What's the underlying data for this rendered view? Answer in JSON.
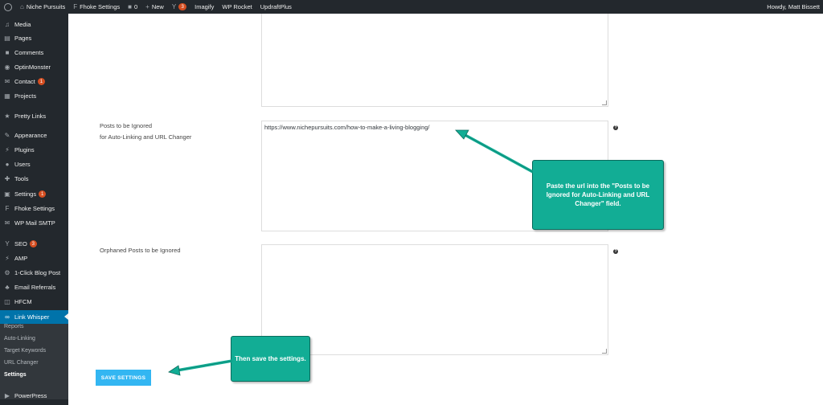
{
  "admin_bar": {
    "site_name": "Niche Pursuits",
    "fhoke": "Fhoke Settings",
    "comments_count": "0",
    "new_label": "New",
    "yoast_badge": "3",
    "imagify": "Imagify",
    "wp_rocket": "WP Rocket",
    "updraft": "UpdraftPlus",
    "howdy": "Howdy, Matt Bissett"
  },
  "sidebar": {
    "items": [
      {
        "label": "Media",
        "icon": "media-icon",
        "glyph": "♫"
      },
      {
        "label": "Pages",
        "icon": "pages-icon",
        "glyph": "▤"
      },
      {
        "label": "Comments",
        "icon": "comments-icon",
        "glyph": "■"
      },
      {
        "label": "OptinMonster",
        "icon": "optinmonster-icon",
        "glyph": "◉"
      },
      {
        "label": "Contact",
        "icon": "contact-icon",
        "glyph": "✉",
        "badge": "1"
      },
      {
        "label": "Projects",
        "icon": "projects-icon",
        "glyph": "▦"
      },
      {
        "label": "Pretty Links",
        "icon": "pretty-links-icon",
        "glyph": "★"
      },
      {
        "label": "Appearance",
        "icon": "appearance-icon",
        "glyph": "✎"
      },
      {
        "label": "Plugins",
        "icon": "plugins-icon",
        "glyph": "⚡"
      },
      {
        "label": "Users",
        "icon": "users-icon",
        "glyph": "●"
      },
      {
        "label": "Tools",
        "icon": "tools-icon",
        "glyph": "✚"
      },
      {
        "label": "Settings",
        "icon": "settings-icon",
        "glyph": "▣",
        "badge": "1"
      },
      {
        "label": "Fhoke Settings",
        "icon": "fhoke-icon",
        "glyph": "F"
      },
      {
        "label": "WP Mail SMTP",
        "icon": "mail-smtp-icon",
        "glyph": "✉"
      },
      {
        "label": "SEO",
        "icon": "seo-icon",
        "glyph": "Y",
        "badge": "3"
      },
      {
        "label": "AMP",
        "icon": "amp-icon",
        "glyph": "⚡"
      },
      {
        "label": "1-Click Blog Post",
        "icon": "gear-icon",
        "glyph": "⚙"
      },
      {
        "label": "Email Referrals",
        "icon": "email-referrals-icon",
        "glyph": "♣"
      },
      {
        "label": "HFCM",
        "icon": "hfcm-icon",
        "glyph": "◫"
      },
      {
        "label": "Link Whisper",
        "icon": "link-icon",
        "glyph": "∞"
      }
    ],
    "submenu": [
      "Reports",
      "Auto-Linking",
      "Target Keywords",
      "URL Changer",
      "Settings"
    ],
    "bottom": {
      "label": "PowerPress",
      "icon": "powerpress-icon",
      "glyph": "▶"
    }
  },
  "form": {
    "posts_ignored_label_1": "Posts to be Ignored",
    "posts_ignored_label_2": "for Auto-Linking and URL Changer",
    "posts_ignored_value": "https://www.nichepursuits.com/how-to-make-a-living-blogging/",
    "orphaned_label": "Orphaned Posts to be Ignored",
    "help_glyph": "?",
    "save_button": "SAVE SETTINGS"
  },
  "callouts": {
    "paste": "Paste the url into the \"Posts to be Ignored for Auto-Linking and URL Changer\" field.",
    "save": "Then save the settings."
  },
  "colors": {
    "callout": "#12ad95",
    "save_button": "#33b6f2",
    "active_menu": "#0073aa"
  }
}
